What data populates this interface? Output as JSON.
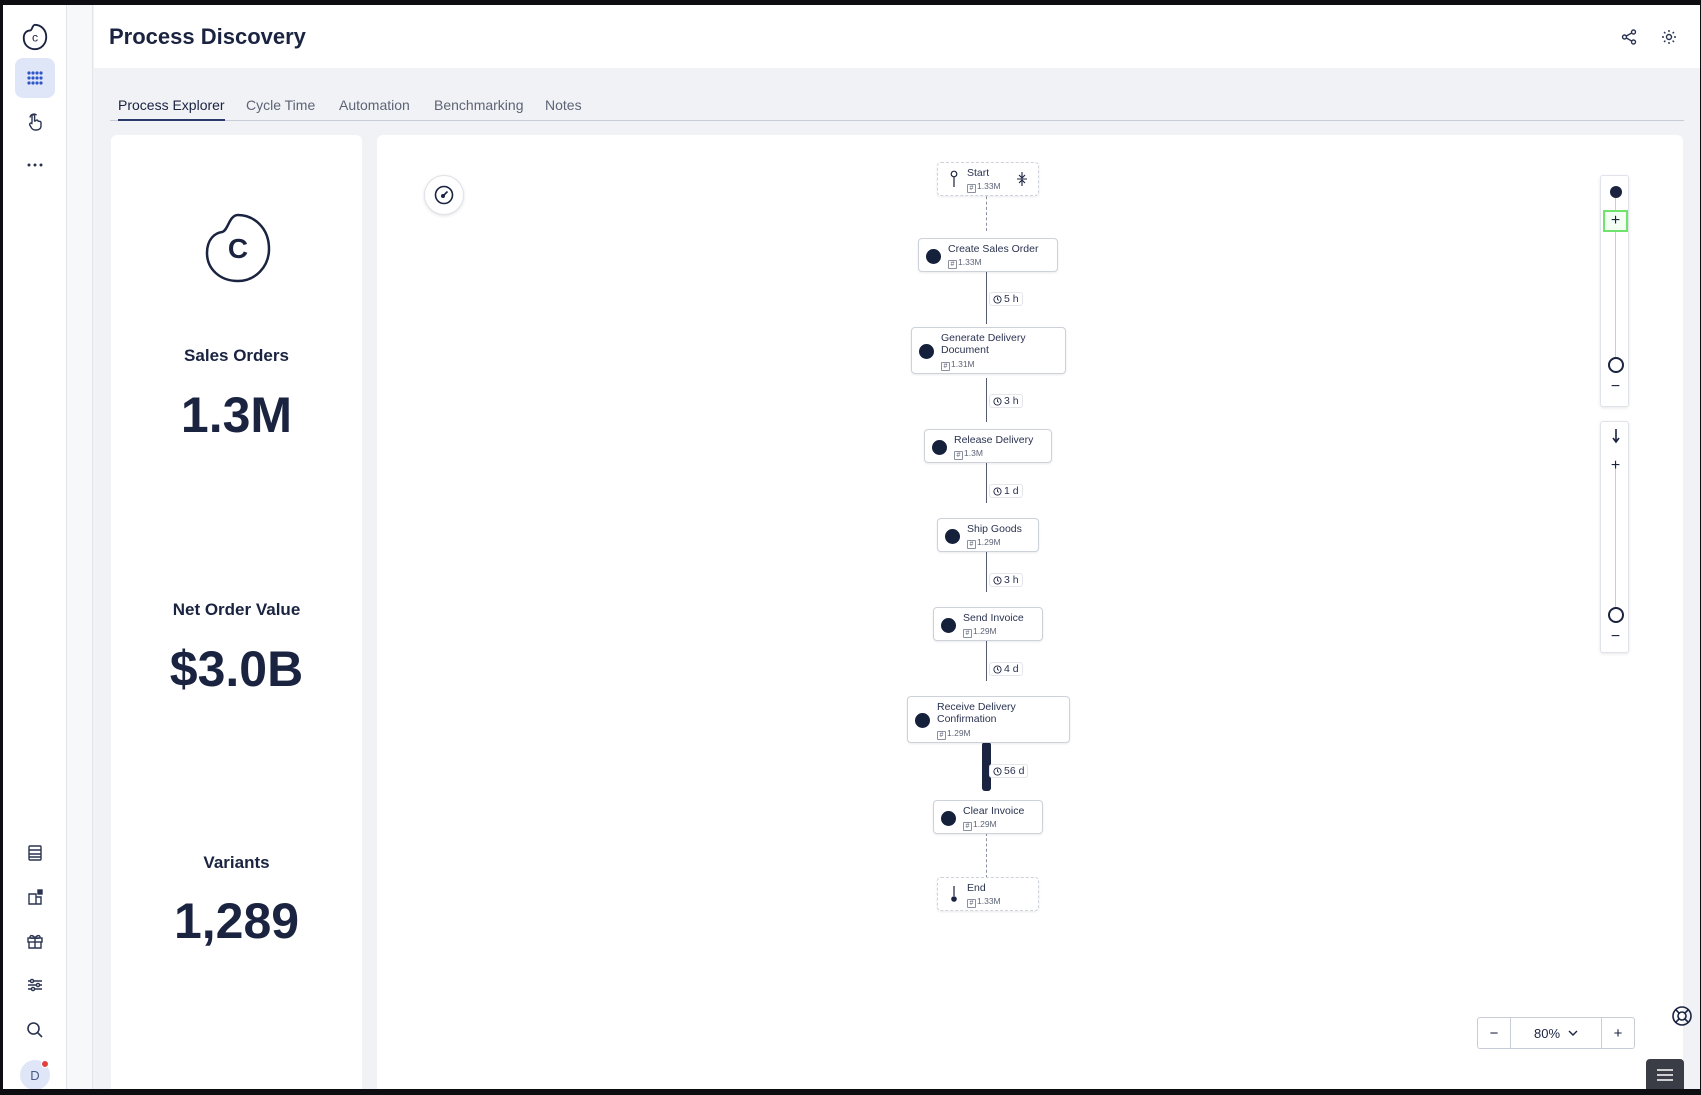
{
  "app": {
    "title": "Process Discovery"
  },
  "sidebar": {
    "avatar_initial": "D",
    "items": [
      {
        "icon": "logo-icon"
      },
      {
        "icon": "apps-grid-icon",
        "active": true
      },
      {
        "icon": "hand-pointer-icon"
      },
      {
        "icon": "more-horizontal-icon"
      },
      {
        "icon": "table-icon"
      },
      {
        "icon": "dashboard-add-icon"
      },
      {
        "icon": "gift-icon"
      },
      {
        "icon": "sliders-icon"
      },
      {
        "icon": "search-icon"
      }
    ]
  },
  "header": {
    "icons": [
      "share-icon",
      "settings-gear-icon"
    ]
  },
  "tabs": [
    {
      "label": "Process Explorer",
      "active": true
    },
    {
      "label": "Cycle Time"
    },
    {
      "label": "Automation"
    },
    {
      "label": "Benchmarking"
    },
    {
      "label": "Notes"
    }
  ],
  "kpis": [
    {
      "label": "Sales Orders",
      "value": "1.3M"
    },
    {
      "label": "Net Order Value",
      "value": "$3.0B"
    },
    {
      "label": "Variants",
      "value": "1,289"
    }
  ],
  "process": {
    "nodes": [
      {
        "name": "Start",
        "count": "1.33M",
        "kind": "start"
      },
      {
        "name": "Create Sales Order",
        "count": "1.33M"
      },
      {
        "name": "Generate Delivery",
        "name2": "Document",
        "count": "1.31M"
      },
      {
        "name": "Release Delivery",
        "count": "1.3M"
      },
      {
        "name": "Ship Goods",
        "count": "1.29M"
      },
      {
        "name": "Send Invoice",
        "count": "1.29M"
      },
      {
        "name": "Receive Delivery",
        "name2": "Confirmation",
        "count": "1.29M"
      },
      {
        "name": "Clear Invoice",
        "count": "1.29M"
      },
      {
        "name": "End",
        "count": "1.33M",
        "kind": "end"
      }
    ],
    "durations": [
      "5 h",
      "3 h",
      "1 d",
      "3 h",
      "4 d",
      "56 d"
    ]
  },
  "zoom": {
    "value": "80%",
    "minus": "−",
    "plus": "+"
  },
  "colors": {
    "primary": "#1a2340",
    "highlight": "#6fe36b",
    "accent": "#2f56c8"
  }
}
